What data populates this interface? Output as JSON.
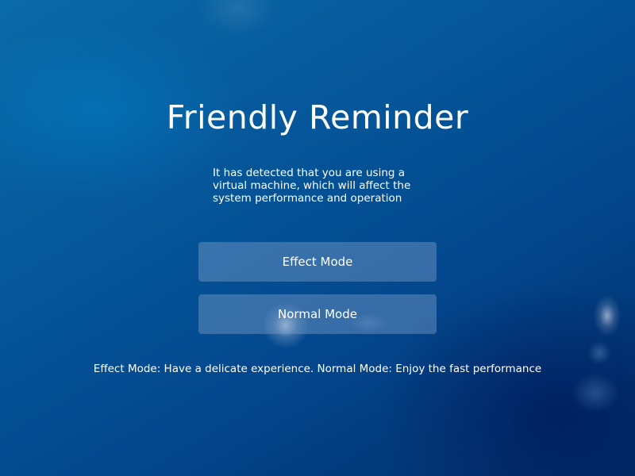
{
  "dialog": {
    "title": "Friendly Reminder",
    "message_lines": [
      "It has detected that you are using a",
      "virtual machine, which will affect the",
      "system performance and operation"
    ],
    "buttons": {
      "effect_mode": "Effect Mode",
      "normal_mode": "Normal Mode"
    },
    "hint": "Effect Mode: Have a delicate experience. Normal Mode: Enjoy the fast performance"
  },
  "colors": {
    "background_top": "#0a6aa8",
    "background_bottom": "#012d68",
    "button_fill": "rgba(120,155,200,0.45)",
    "text": "#ffffff"
  }
}
